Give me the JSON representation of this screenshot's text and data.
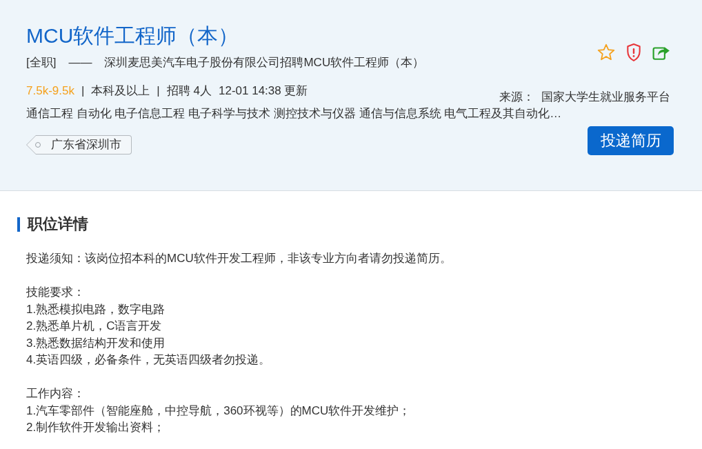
{
  "job_header": {
    "title": "MCU软件工程师（本）",
    "job_type": "[全职]",
    "separator": "——",
    "subtitle": "深圳麦思美汽车电子股份有限公司招聘MCU软件工程师（本）",
    "meta": [
      {
        "kind": "salary",
        "text": "7.5k-9.5k"
      },
      {
        "kind": "divider",
        "text": "|"
      },
      {
        "kind": "plain",
        "text": "本科及以上"
      },
      {
        "kind": "divider",
        "text": "|"
      },
      {
        "kind": "plain",
        "text": "招聘 4人"
      },
      {
        "kind": "plain",
        "text": "12-01 14:38 更新"
      }
    ],
    "source_label": "来源：",
    "source": "国家大学生就业服务平台",
    "majors": "通信工程 自动化 电子信息工程 电子科学与技术 测控技术与仪器 通信与信息系统 电气工程及其自动化…",
    "location": "广东省深圳市",
    "apply_button": "投递简历"
  },
  "details": {
    "heading": "职位详情",
    "paragraphs": [
      {
        "lines": [
          "投递须知：该岗位招本科的MCU软件开发工程师，非该专业方向者请勿投递简历。"
        ]
      },
      {
        "lines": [
          "技能要求：",
          "1.熟悉模拟电路，数字电路",
          "2.熟悉单片机，C语言开发",
          "3.熟悉数据结构开发和使用",
          "4.英语四级，必备条件，无英语四级者勿投递。"
        ]
      },
      {
        "lines": [
          "工作内容：",
          "1.汽车零部件（智能座舱，中控导航，360环视等）的MCU软件开发维护；",
          "2.制作软件开发输出资料；"
        ]
      }
    ]
  }
}
